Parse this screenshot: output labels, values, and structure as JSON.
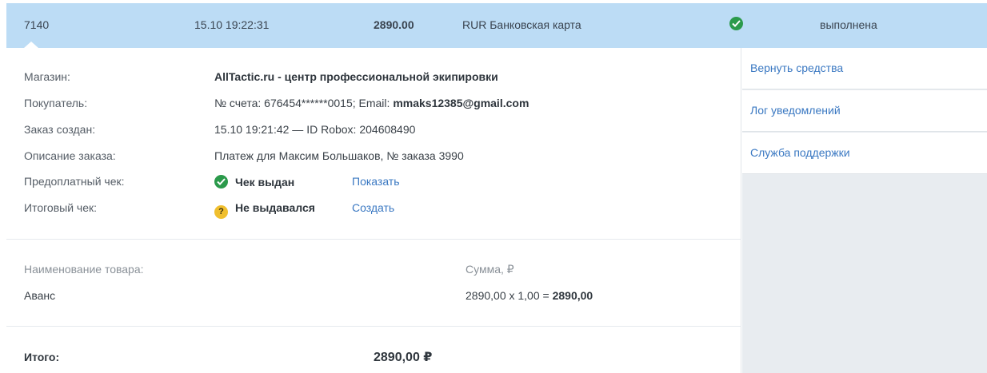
{
  "transaction": {
    "id": "7140",
    "datetime": "15.10 19:22:31",
    "amount": "2890.00",
    "method": "RUR Банковская карта",
    "status": "выполнена"
  },
  "details": {
    "store_label": "Магазин:",
    "store_value": "AllTactic.ru - центр профессиональной экипировки",
    "buyer_label": "Покупатель:",
    "buyer_prefix": "№ счета: 676454******0015; Email: ",
    "buyer_email": "mmaks12385@gmail.com",
    "created_label": "Заказ создан:",
    "created_value": "15.10 19:21:42 — ID Robox: 204608490",
    "description_label": "Описание заказа:",
    "description_value": "Платеж для Максим Большаков, № заказа 3990",
    "prepay_label": "Предоплатный чек:",
    "prepay_status": "Чек выдан",
    "prepay_link": "Показать",
    "final_label": "Итоговый чек:",
    "final_status": "Не выдавался",
    "final_link": "Создать",
    "final_icon_glyph": "?"
  },
  "items": {
    "header_name": "Наименование товара:",
    "header_sum": "Сумма, ₽",
    "rows": [
      {
        "name": "Аванс",
        "calc": "2890,00 x 1,00 = ",
        "total": "2890,00"
      }
    ]
  },
  "total": {
    "label": "Итого:",
    "value": "2890,00 ₽"
  },
  "actions": [
    {
      "label": "Вернуть средства"
    },
    {
      "label": "Лог уведомлений"
    },
    {
      "label": "Служба поддержки"
    }
  ],
  "colors": {
    "header_bg": "#bcdcf5",
    "link": "#3a78c2",
    "success": "#2b9a4b",
    "warning": "#f0bf2e",
    "sidebar_bg": "#e8ecf0"
  },
  "icons": {
    "status": "check-circle-icon",
    "prepay": "check-circle-icon",
    "final": "question-circle-icon"
  }
}
